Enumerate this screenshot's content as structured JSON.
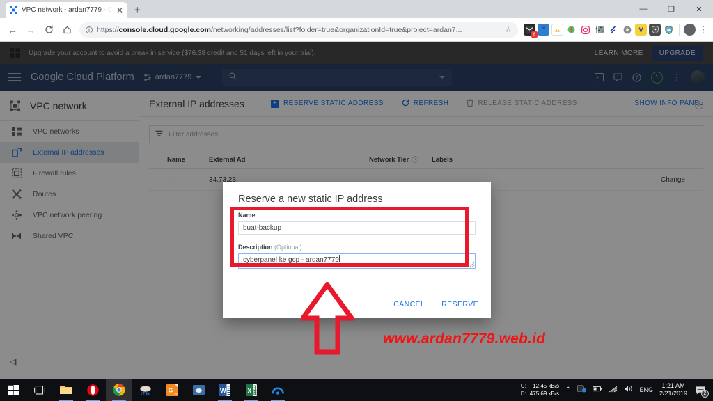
{
  "browser": {
    "tab": {
      "title": "VPC network - ardan7779 - Goog",
      "favicon": "vpc-network-icon",
      "close": "✕"
    },
    "newtab_label": "+",
    "window_controls": {
      "minimize": "—",
      "maximize": "❐",
      "close": "✕"
    },
    "nav": {
      "back": "←",
      "forward": "→",
      "reload": "C",
      "home": "⌂"
    },
    "omnibox": {
      "info_icon": "i",
      "url_prefix": "https://",
      "url_bold": "console.cloud.google.com",
      "url_rest": "/networking/addresses/list?folder=true&organizationId=true&project=ardan7...",
      "star": "☆"
    },
    "extensions": [
      {
        "name": "mail-extension-icon",
        "color": "#2b2b2b",
        "glyph": "",
        "badge": "6"
      },
      {
        "name": "toolbox-extension-icon",
        "color": "#2f7fd0",
        "glyph": ""
      },
      {
        "name": "image-extension-icon",
        "color": "#f2c230",
        "glyph": ""
      },
      {
        "name": "money-extension-icon",
        "color": "#e8552d",
        "glyph": ""
      },
      {
        "name": "instagram-extension-icon",
        "color": "#e1306c",
        "glyph": ""
      },
      {
        "name": "equalizer-extension-icon",
        "color": "#3c3c3c",
        "glyph": ""
      },
      {
        "name": "check-extension-icon",
        "color": "#1f3a93",
        "glyph": ""
      },
      {
        "name": "flash-extension-icon",
        "color": "#6b6b6b",
        "glyph": ""
      },
      {
        "name": "vpn-extension-icon",
        "color": "#f3c623",
        "glyph": "V"
      },
      {
        "name": "shield-extension-icon",
        "color": "#4a4a4a",
        "glyph": ""
      },
      {
        "name": "ublock-extension-icon",
        "color": "#22a06b",
        "glyph": ""
      }
    ],
    "menu_kebab": "⋮"
  },
  "promo": {
    "icon": "gift-icon",
    "message": "Upgrade your account to avoid a break in service ($76.38 credit and 51 days left in your trial).",
    "learn_more": "LEARN MORE",
    "upgrade": "UPGRADE"
  },
  "gcp_header": {
    "menu_icon": "hamburger-icon",
    "brand": "Google Cloud Platform",
    "project": "ardan7779",
    "search_placeholder": "",
    "search_icon": "search-icon",
    "icons": [
      {
        "name": "cloud-shell-icon",
        "glyph": "▣"
      },
      {
        "name": "notifications-icon",
        "glyph": "!"
      },
      {
        "name": "help-icon",
        "glyph": "?"
      }
    ],
    "badge_count": "1",
    "kebab": "⋮"
  },
  "sidebar": {
    "title": "VPC network",
    "title_icon": "vpc-network-icon",
    "items": [
      {
        "label": "VPC networks",
        "icon": "network-list-icon",
        "active": false
      },
      {
        "label": "External IP addresses",
        "icon": "external-ip-icon",
        "active": true
      },
      {
        "label": "Firewall rules",
        "icon": "firewall-icon",
        "active": false
      },
      {
        "label": "Routes",
        "icon": "routes-icon",
        "active": false
      },
      {
        "label": "VPC network peering",
        "icon": "peering-icon",
        "active": false
      },
      {
        "label": "Shared VPC",
        "icon": "shared-vpc-icon",
        "active": false
      }
    ],
    "collapse_label": "◁|"
  },
  "content": {
    "title": "External IP addresses",
    "actions": [
      {
        "label": "RESERVE STATIC ADDRESS",
        "icon": "plus-square-icon",
        "disabled": false
      },
      {
        "label": "REFRESH",
        "icon": "refresh-icon",
        "disabled": false
      },
      {
        "label": "RELEASE STATIC ADDRESS",
        "icon": "trash-icon",
        "disabled": true
      }
    ],
    "show_info_panel": "SHOW INFO PANEL",
    "filter": {
      "icon": "filter-icon",
      "placeholder": "Filter addresses",
      "help": "?"
    },
    "table": {
      "columns": [
        "Name",
        "External Ad",
        "Network Tier",
        "Labels"
      ],
      "rows": [
        {
          "name": "–",
          "external_address": "34.73.23.",
          "network_tier": "",
          "labels": "",
          "change": "Change"
        }
      ]
    }
  },
  "dialog": {
    "title": "Reserve a new static IP address",
    "name_label": "Name",
    "name_value": "buat-backup",
    "description_label": "Description",
    "description_optional": "(Optional)",
    "description_value": "cyberpanel ke gcp - ardan7779",
    "cancel": "CANCEL",
    "reserve": "RESERVE"
  },
  "annotations": {
    "highlight_color": "#e8192c",
    "arrow_color": "#e8192c",
    "watermark": "www.ardan7779.web.id",
    "watermark_color": "#f01414"
  },
  "taskbar": {
    "items": [
      {
        "name": "start-button-icon",
        "active": false,
        "running": false
      },
      {
        "name": "task-view-icon",
        "active": false,
        "running": false
      },
      {
        "name": "file-explorer-icon",
        "active": false,
        "running": true
      },
      {
        "name": "opera-browser-icon",
        "active": false,
        "running": true
      },
      {
        "name": "google-chrome-icon",
        "active": true,
        "running": true
      },
      {
        "name": "snipping-tool-icon",
        "active": false,
        "running": false
      },
      {
        "name": "pdf-reader-icon",
        "active": false,
        "running": false
      },
      {
        "name": "mail-app-icon",
        "active": false,
        "running": false
      },
      {
        "name": "microsoft-word-icon",
        "active": false,
        "running": true
      },
      {
        "name": "microsoft-excel-icon",
        "active": false,
        "running": true
      },
      {
        "name": "teamviewer-icon",
        "active": false,
        "running": true
      }
    ],
    "tray": {
      "upload_label": "U:",
      "upload_value": "12.45 kB/s",
      "download_label": "D:",
      "download_value": "475.69 kB/s",
      "chevron": "⌃",
      "icons": [
        {
          "name": "security-shield-icon",
          "glyph": "▣"
        },
        {
          "name": "battery-icon",
          "glyph": "▭"
        },
        {
          "name": "wifi-icon",
          "glyph": "◢"
        },
        {
          "name": "volume-icon",
          "glyph": "◀"
        }
      ],
      "language": "ENG",
      "time": "1:21 AM",
      "date": "2/21/2019",
      "notification_count": "2"
    }
  }
}
